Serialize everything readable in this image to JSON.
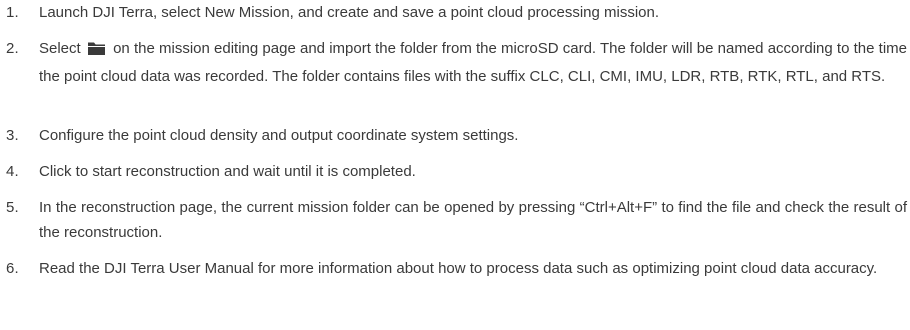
{
  "steps": [
    {
      "number": "1.",
      "text": "Launch DJI Terra, select New Mission, and create and save a point cloud processing mission."
    },
    {
      "number": "2.",
      "text_before_icon": "Select ",
      "icon": "folder-icon",
      "text_after_icon": " on the mission editing page and import the folder from the microSD card. The folder will be named according to the time the point cloud data was recorded. The folder contains files with the suffix CLC, CLI, CMI, IMU, LDR, RTB, RTK, RTL, and RTS."
    },
    {
      "number": "3.",
      "text": "Configure the point cloud density and output coordinate system settings."
    },
    {
      "number": "4.",
      "text": "Click to start reconstruction and wait until it is completed."
    },
    {
      "number": "5.",
      "text": "In the reconstruction page, the current mission folder can be opened by pressing “Ctrl+Alt+F” to find the file and check the result of the reconstruction."
    },
    {
      "number": "6.",
      "text": "Read the DJI Terra User Manual for more information about how to process data such as optimizing point cloud data accuracy."
    }
  ],
  "colors": {
    "text": "#3a3a3a",
    "icon": "#3a3a3a"
  }
}
